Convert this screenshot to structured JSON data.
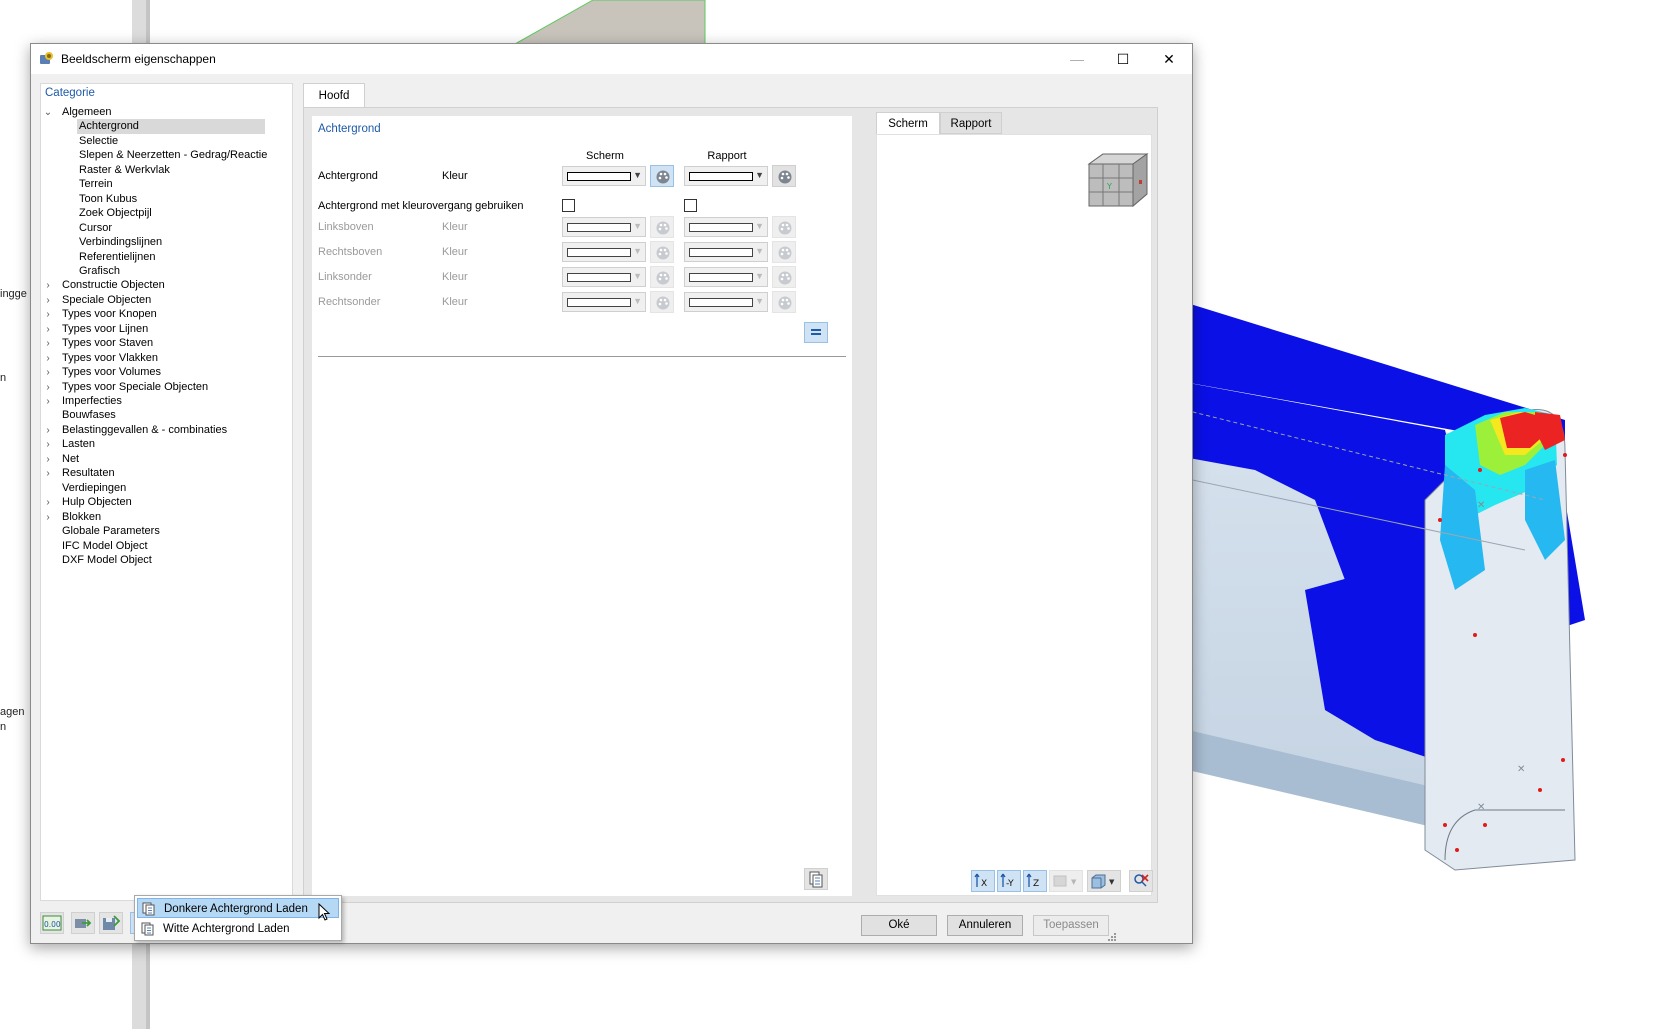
{
  "background": {
    "labels": [
      "ingge",
      "en",
      "agen",
      "n"
    ]
  },
  "dialog": {
    "title": "Beeldscherm eigenschappen",
    "window_buttons": {
      "minimize": "—",
      "maximize": "☐",
      "close": "✕"
    }
  },
  "category_panel": {
    "header": "Categorie",
    "items": [
      {
        "label": "Algemeen",
        "expanded": true,
        "level": 0
      },
      {
        "label": "Achtergrond",
        "level": 1,
        "selected": true
      },
      {
        "label": "Selectie",
        "level": 1
      },
      {
        "label": "Slepen & Neerzetten - Gedrag/Reactie",
        "level": 1
      },
      {
        "label": "Raster & Werkvlak",
        "level": 1
      },
      {
        "label": "Terrein",
        "level": 1
      },
      {
        "label": "Toon Kubus",
        "level": 1
      },
      {
        "label": "Zoek Objectpijl",
        "level": 1
      },
      {
        "label": "Cursor",
        "level": 1
      },
      {
        "label": "Verbindingslijnen",
        "level": 1
      },
      {
        "label": "Referentielijnen",
        "level": 1
      },
      {
        "label": "Grafisch",
        "level": 1
      },
      {
        "label": "Constructie Objecten",
        "level": 0,
        "expandable": true
      },
      {
        "label": "Speciale Objecten",
        "level": 0,
        "expandable": true
      },
      {
        "label": "Types voor Knopen",
        "level": 0,
        "expandable": true
      },
      {
        "label": "Types voor Lijnen",
        "level": 0,
        "expandable": true
      },
      {
        "label": "Types voor Staven",
        "level": 0,
        "expandable": true
      },
      {
        "label": "Types voor Vlakken",
        "level": 0,
        "expandable": true
      },
      {
        "label": "Types voor Volumes",
        "level": 0,
        "expandable": true
      },
      {
        "label": "Types voor Speciale Objecten",
        "level": 0,
        "expandable": true
      },
      {
        "label": "Imperfecties",
        "level": 0,
        "expandable": true
      },
      {
        "label": "Bouwfases",
        "level": 0
      },
      {
        "label": "Belastinggevallen & - combinaties",
        "level": 0,
        "expandable": true
      },
      {
        "label": "Lasten",
        "level": 0,
        "expandable": true
      },
      {
        "label": "Net",
        "level": 0,
        "expandable": true
      },
      {
        "label": "Resultaten",
        "level": 0,
        "expandable": true
      },
      {
        "label": "Verdiepingen",
        "level": 0
      },
      {
        "label": "Hulp Objecten",
        "level": 0,
        "expandable": true
      },
      {
        "label": "Blokken",
        "level": 0,
        "expandable": true
      },
      {
        "label": "Globale Parameters",
        "level": 0
      },
      {
        "label": "IFC Model Object",
        "level": 0
      },
      {
        "label": "DXF Model Object",
        "level": 0
      }
    ]
  },
  "main": {
    "tab": "Hoofd",
    "section_title": "Achtergrond",
    "col_screen": "Scherm",
    "col_report": "Rapport",
    "rows": {
      "background": {
        "label": "Achtergrond",
        "sub": "Kleur"
      },
      "gradient": {
        "label": "Achtergrond met kleurovergang gebruiken"
      },
      "top_left": {
        "label": "Linksboven",
        "sub": "Kleur"
      },
      "top_right": {
        "label": "Rechtsboven",
        "sub": "Kleur"
      },
      "bottom_left": {
        "label": "Linksonder",
        "sub": "Kleur"
      },
      "bottom_right": {
        "label": "Rechtsonder",
        "sub": "Kleur"
      }
    }
  },
  "preview": {
    "tabs": [
      "Scherm",
      "Rapport"
    ]
  },
  "footer": {
    "ok": "Oké",
    "cancel": "Annuleren",
    "apply": "Toepassen"
  },
  "menu": {
    "items": [
      "Donkere Achtergrond Laden",
      "Witte Achtergrond Laden"
    ]
  },
  "colors": {
    "accent": "#1e5aa8",
    "selection": "#d9d9d9",
    "menu_hover": "#b5d8f5"
  }
}
